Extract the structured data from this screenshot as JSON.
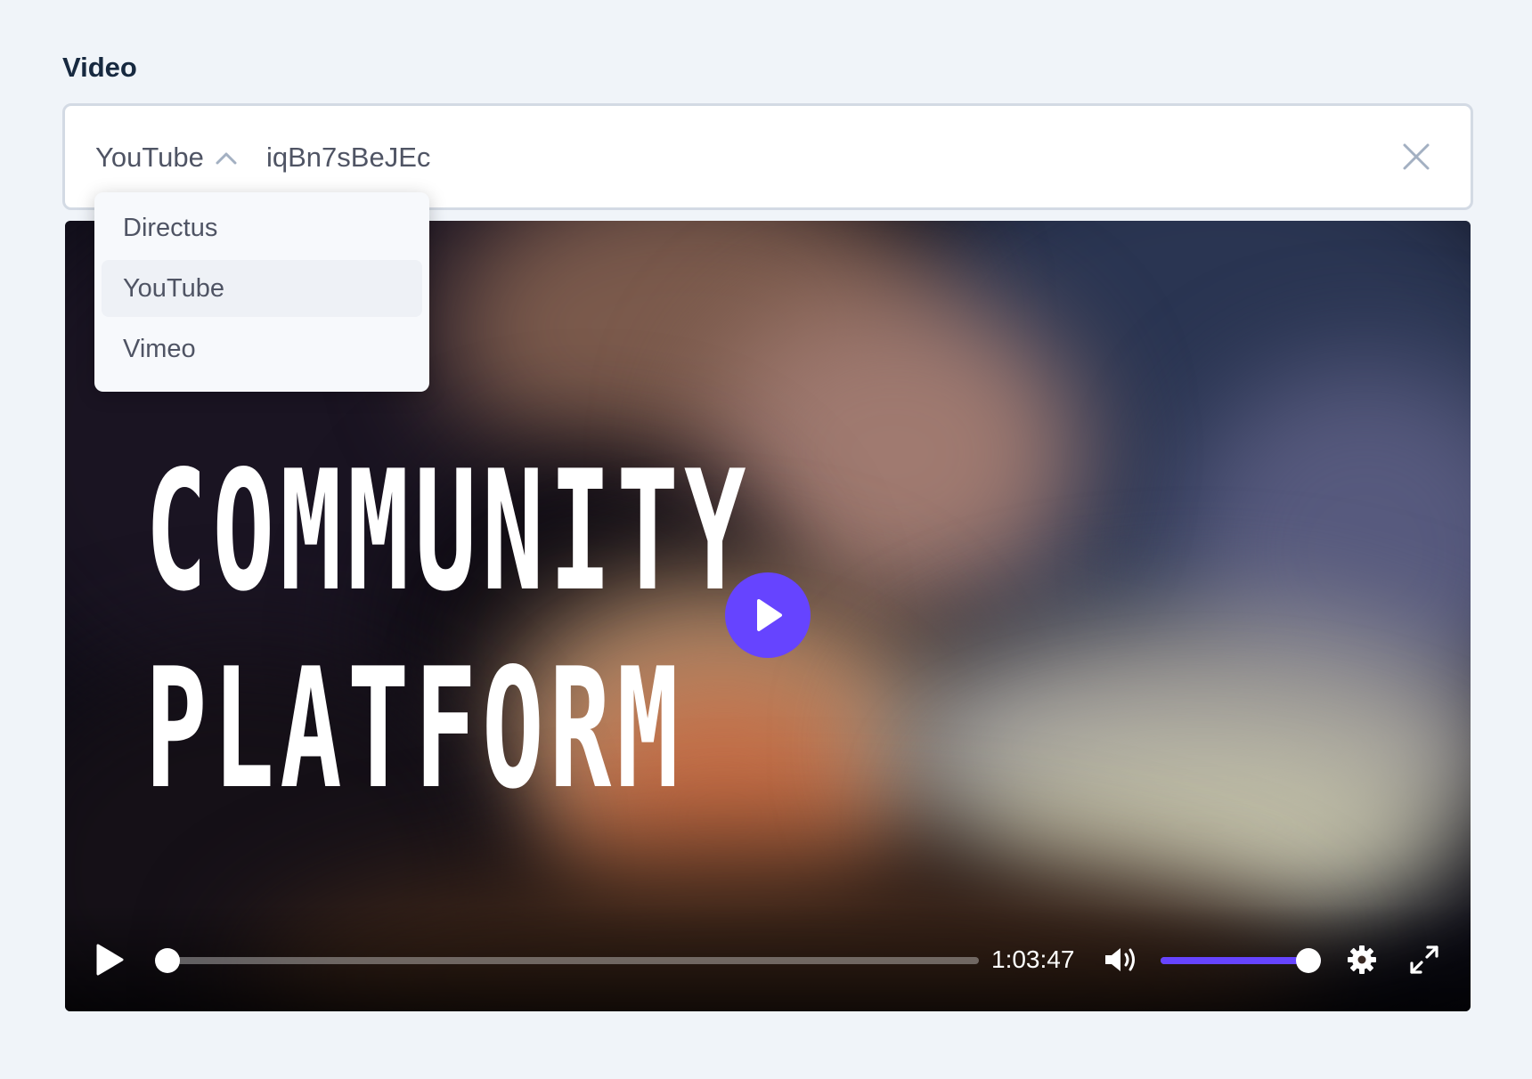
{
  "field": {
    "label": "Video"
  },
  "input": {
    "provider": "YouTube",
    "video_id": "iqBn7sBeJEc",
    "clear_icon": "close-icon",
    "dropdown_icon": "chevron-up-icon"
  },
  "dropdown": {
    "items": [
      "Directus",
      "YouTube",
      "Vimeo"
    ],
    "selected": "YouTube"
  },
  "player": {
    "thumbnail_title_line1": "COMMUNITY",
    "thumbnail_title_line2": "PLATFORM",
    "duration": "1:03:47",
    "progress": 0,
    "volume": 1.0,
    "accent_color": "#6644ff"
  }
}
